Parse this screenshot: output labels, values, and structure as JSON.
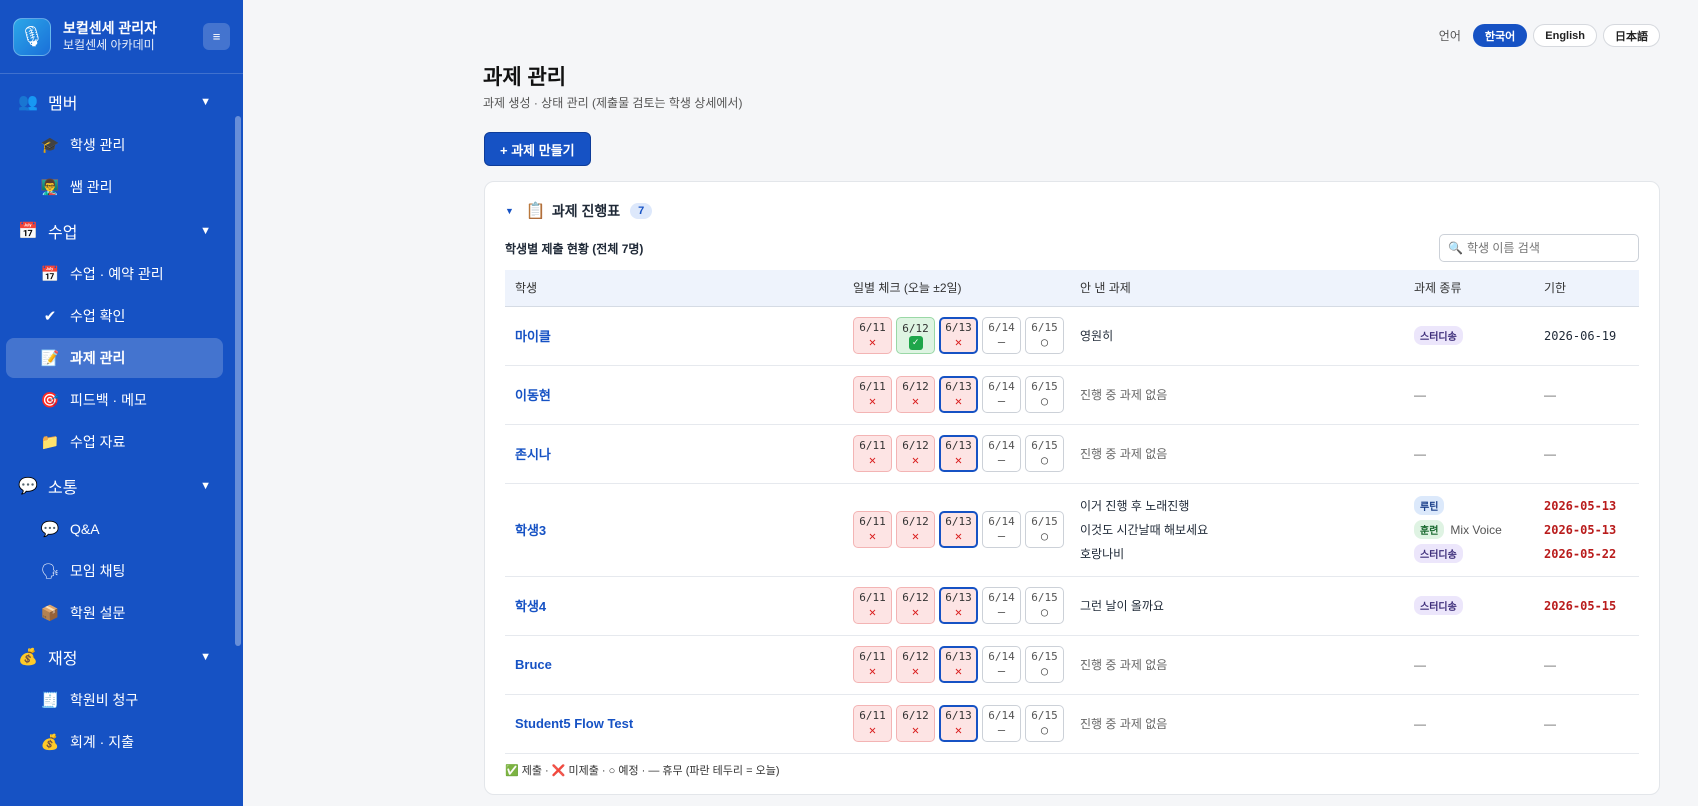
{
  "sidebar": {
    "title": "보컬센세 관리자",
    "subtitle": "보컬센세 아카데미",
    "toggle": "≡",
    "groups": [
      {
        "label": "멤버",
        "icon": "👥",
        "items": [
          {
            "label": "학생 관리",
            "icon": "🎓"
          },
          {
            "label": "쌤 관리",
            "icon": "👨‍🏫"
          }
        ]
      },
      {
        "label": "수업",
        "icon": "📅",
        "items": [
          {
            "label": "수업 · 예약 관리",
            "icon": "📅"
          },
          {
            "label": "수업 확인",
            "icon": "✔"
          },
          {
            "label": "과제 관리",
            "icon": "📝",
            "active": true
          },
          {
            "label": "피드백 · 메모",
            "icon": "🎯"
          },
          {
            "label": "수업 자료",
            "icon": "📁"
          }
        ]
      },
      {
        "label": "소통",
        "icon": "💬",
        "items": [
          {
            "label": "Q&A",
            "icon": "💬"
          },
          {
            "label": "모임 채팅",
            "icon": "🗣"
          },
          {
            "label": "학원 설문",
            "icon": "📦"
          }
        ]
      },
      {
        "label": "재정",
        "icon": "💰",
        "items": [
          {
            "label": "학원비 청구",
            "icon": "🧾"
          },
          {
            "label": "회계 · 지출",
            "icon": "💰"
          }
        ]
      }
    ]
  },
  "language": {
    "label": "언어",
    "options": [
      "한국어",
      "English",
      "日本語"
    ],
    "selected": "한국어"
  },
  "page": {
    "title": "과제 관리",
    "subtitle": "과제 생성 · 상태 관리 (제출물 검토는 학생 상세에서)",
    "create_button": "+ 과제 만들기"
  },
  "card": {
    "title": "과제 진행표",
    "count": "7",
    "summary": "학생별 제출 현황 (전체 7명)",
    "search_placeholder": "학생 이름 검색",
    "columns": [
      "학생",
      "일별 체크 (오늘 ±2일)",
      "안 낸 과제",
      "과제 종류",
      "기한"
    ],
    "legend": "✅ 제출 · ❌ 미제출 · ○ 예정 · — 휴무 (파란 테두리 = 오늘)"
  },
  "marks": {
    "missed": "✕",
    "submitted": "✓",
    "off": "—",
    "planned": "○"
  },
  "students": [
    {
      "name": "마이클",
      "days": [
        {
          "d": "6/11",
          "s": "missed"
        },
        {
          "d": "6/12",
          "s": "submitted"
        },
        {
          "d": "6/13",
          "s": "missed",
          "today": true
        },
        {
          "d": "6/14",
          "s": "off"
        },
        {
          "d": "6/15",
          "s": "planned"
        }
      ],
      "tasks": [
        {
          "title": "영원히",
          "type": "스터디송",
          "kind": "study",
          "extra": "",
          "due": "2026-06-19",
          "late": false
        }
      ]
    },
    {
      "name": "이동현",
      "days": [
        {
          "d": "6/11",
          "s": "missed"
        },
        {
          "d": "6/12",
          "s": "missed"
        },
        {
          "d": "6/13",
          "s": "missed",
          "today": true
        },
        {
          "d": "6/14",
          "s": "off"
        },
        {
          "d": "6/15",
          "s": "planned"
        }
      ],
      "none": "진행 중 과제 없음"
    },
    {
      "name": "존시나",
      "days": [
        {
          "d": "6/11",
          "s": "missed"
        },
        {
          "d": "6/12",
          "s": "missed"
        },
        {
          "d": "6/13",
          "s": "missed",
          "today": true
        },
        {
          "d": "6/14",
          "s": "off"
        },
        {
          "d": "6/15",
          "s": "planned"
        }
      ],
      "none": "진행 중 과제 없음"
    },
    {
      "name": "학생3",
      "days": [
        {
          "d": "6/11",
          "s": "missed"
        },
        {
          "d": "6/12",
          "s": "missed"
        },
        {
          "d": "6/13",
          "s": "missed",
          "today": true
        },
        {
          "d": "6/14",
          "s": "off"
        },
        {
          "d": "6/15",
          "s": "planned"
        }
      ],
      "tasks": [
        {
          "title": "이거 진행 후 노래진행",
          "type": "루틴",
          "kind": "routine",
          "extra": "",
          "due": "2026-05-13",
          "late": true
        },
        {
          "title": "이것도 시간날때 해보세요",
          "type": "훈련",
          "kind": "train",
          "extra": "Mix Voice",
          "due": "2026-05-13",
          "late": true
        },
        {
          "title": "호랑나비",
          "type": "스터디송",
          "kind": "study",
          "extra": "",
          "due": "2026-05-22",
          "late": true
        }
      ]
    },
    {
      "name": "학생4",
      "days": [
        {
          "d": "6/11",
          "s": "missed"
        },
        {
          "d": "6/12",
          "s": "missed"
        },
        {
          "d": "6/13",
          "s": "missed",
          "today": true
        },
        {
          "d": "6/14",
          "s": "off"
        },
        {
          "d": "6/15",
          "s": "planned"
        }
      ],
      "tasks": [
        {
          "title": "그런 날이 올까요",
          "type": "스터디송",
          "kind": "study",
          "extra": "",
          "due": "2026-05-15",
          "late": true
        }
      ]
    },
    {
      "name": "Bruce",
      "days": [
        {
          "d": "6/11",
          "s": "missed"
        },
        {
          "d": "6/12",
          "s": "missed"
        },
        {
          "d": "6/13",
          "s": "missed",
          "today": true
        },
        {
          "d": "6/14",
          "s": "off"
        },
        {
          "d": "6/15",
          "s": "planned"
        }
      ],
      "none": "진행 중 과제 없음"
    },
    {
      "name": "Student5 Flow Test",
      "days": [
        {
          "d": "6/11",
          "s": "missed"
        },
        {
          "d": "6/12",
          "s": "missed"
        },
        {
          "d": "6/13",
          "s": "missed",
          "today": true
        },
        {
          "d": "6/14",
          "s": "off"
        },
        {
          "d": "6/15",
          "s": "planned"
        }
      ],
      "none": "진행 중 과제 없음"
    }
  ],
  "empty_dash": "—"
}
